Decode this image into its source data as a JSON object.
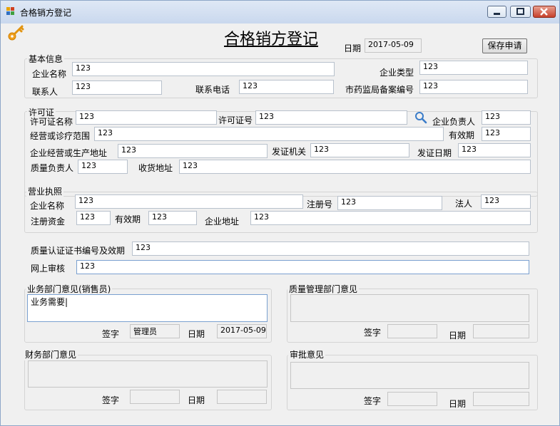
{
  "window": {
    "title": "合格销方登记",
    "accent_color": "#c7402b"
  },
  "header": {
    "title": "合格销方登记",
    "date_label": "日期",
    "date_value": "2017-05-09",
    "save_button": "保存申请"
  },
  "basic": {
    "group_title": "基本信息",
    "company_name_label": "企业名称",
    "company_name_value": "123",
    "company_type_label": "企业类型",
    "company_type_value": "123",
    "contact_label": "联系人",
    "contact_value": "123",
    "phone_label": "联系电话",
    "phone_value": "123",
    "filing_label": "市药监局备案编号",
    "filing_value": "123"
  },
  "license": {
    "group_title": "许可证",
    "name_label": "许可证名称",
    "name_value": "123",
    "number_label": "许可证号",
    "number_value": "123",
    "owner_label": "企业负责人",
    "owner_value": "123",
    "scope_label": "经营或诊疗范围",
    "scope_value": "123",
    "valid_label": "有效期",
    "valid_value": "123",
    "address_label": "企业经营或生产地址",
    "address_value": "123",
    "issuer_label": "发证机关",
    "issuer_value": "123",
    "issue_date_label": "发证日期",
    "issue_date_value": "123",
    "quality_label": "质量负责人",
    "quality_value": "123",
    "receive_label": "收货地址",
    "receive_value": "123"
  },
  "business": {
    "group_title": "营业执照",
    "name_label": "企业名称",
    "name_value": "123",
    "reg_label": "注册号",
    "reg_value": "123",
    "legal_label": "法人",
    "legal_value": "123",
    "capital_label": "注册资金",
    "capital_value": "123",
    "valid_label": "有效期",
    "valid_value": "123",
    "address_label": "企业地址",
    "address_value": "123"
  },
  "cert": {
    "label": "质量认证证书编号及效期",
    "value": "123",
    "online_label": "网上审核",
    "online_value": "123"
  },
  "sales": {
    "group_title": "业务部门意见(销售员)",
    "opinion": "业务需要|",
    "sign_label": "签字",
    "sign_value": "管理员",
    "date_label": "日期",
    "date_value": "2017-05-09"
  },
  "quality": {
    "group_title": "质量管理部门意见",
    "sign_label": "签字",
    "date_label": "日期"
  },
  "finance": {
    "group_title": "财务部门意见",
    "sign_label": "签字",
    "date_label": "日期"
  },
  "approval": {
    "group_title": "审批意见",
    "sign_label": "签字",
    "date_label": "日期"
  }
}
